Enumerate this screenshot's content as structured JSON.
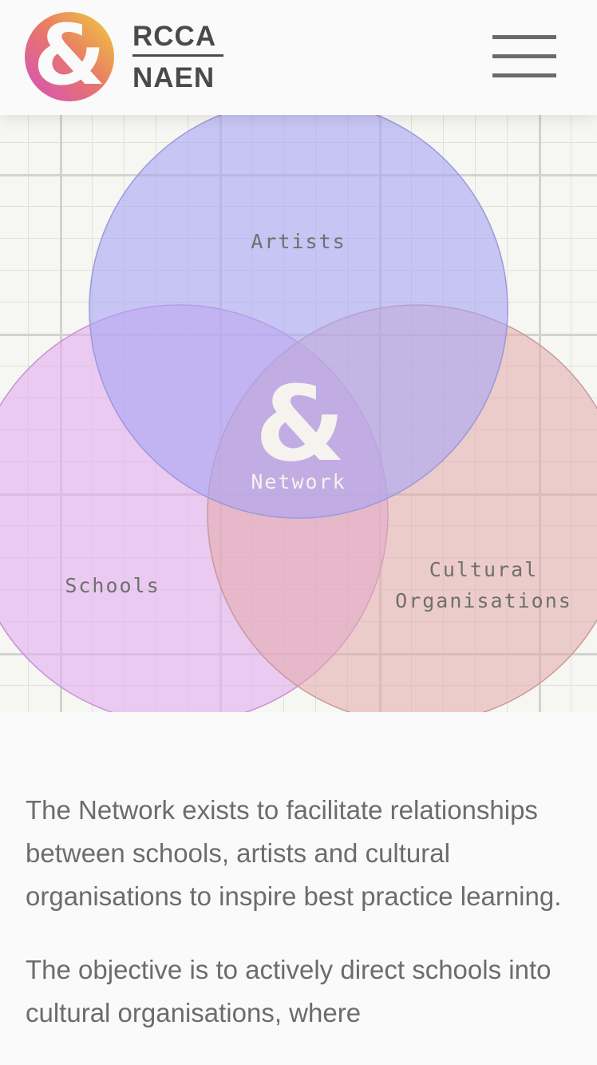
{
  "header": {
    "logo_glyph": "&",
    "brand_top": "RCCA",
    "brand_bottom": "NAEN",
    "menu_icon": "hamburger-menu-icon"
  },
  "venn": {
    "artists_label": "Artists",
    "schools_label": "Schools",
    "cultural_label_line1": "Cultural",
    "cultural_label_line2": "Organisations",
    "center_glyph": "&",
    "network_label": "Network",
    "colors": {
      "artists": "#b8b8f4",
      "schools": "#e6b8ef",
      "cultural": "#e8bcbf"
    }
  },
  "content": {
    "paragraph1": "The Network exists to facilitate relationships between schools, artists and cultural organisations to inspire best practice learning.",
    "paragraph2": "The objective is to actively direct schools into cultural organisations, where"
  }
}
